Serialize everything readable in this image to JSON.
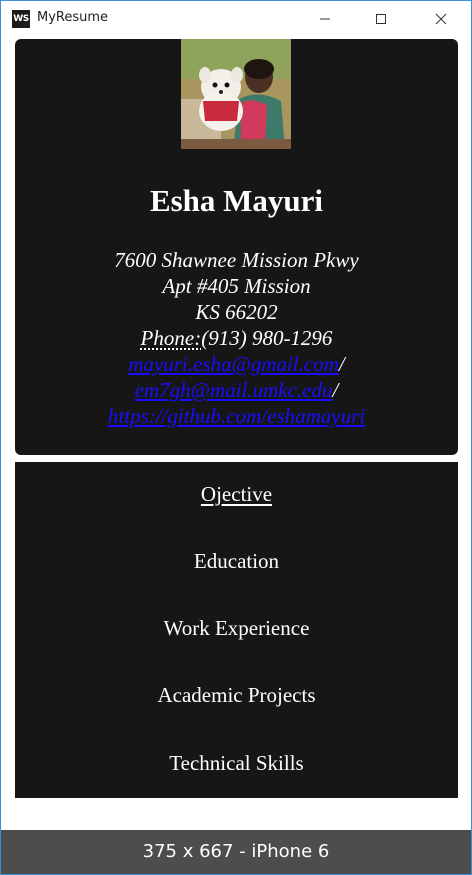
{
  "window": {
    "app_icon_text": "WS",
    "title": "MyResume"
  },
  "profile": {
    "name": "Esha Mayuri",
    "address_line1": "7600 Shawnee Mission Pkwy",
    "address_line2": "Apt #405 Mission",
    "address_line3": "KS 66202",
    "phone_label": "Phone:",
    "phone": "(913) 980-1296",
    "email1": "mayuri.esha@gmail.com",
    "email2": "em7gh@mail.umkc.edu",
    "github": "https://github.com/eshamayuri",
    "separator": "/"
  },
  "nav": {
    "items": [
      {
        "label": "Ojective"
      },
      {
        "label": "Education"
      },
      {
        "label": "Work Experience"
      },
      {
        "label": "Academic Projects"
      },
      {
        "label": "Technical Skills"
      }
    ]
  },
  "device_bar": {
    "label": "375 x 667 - iPhone 6"
  }
}
